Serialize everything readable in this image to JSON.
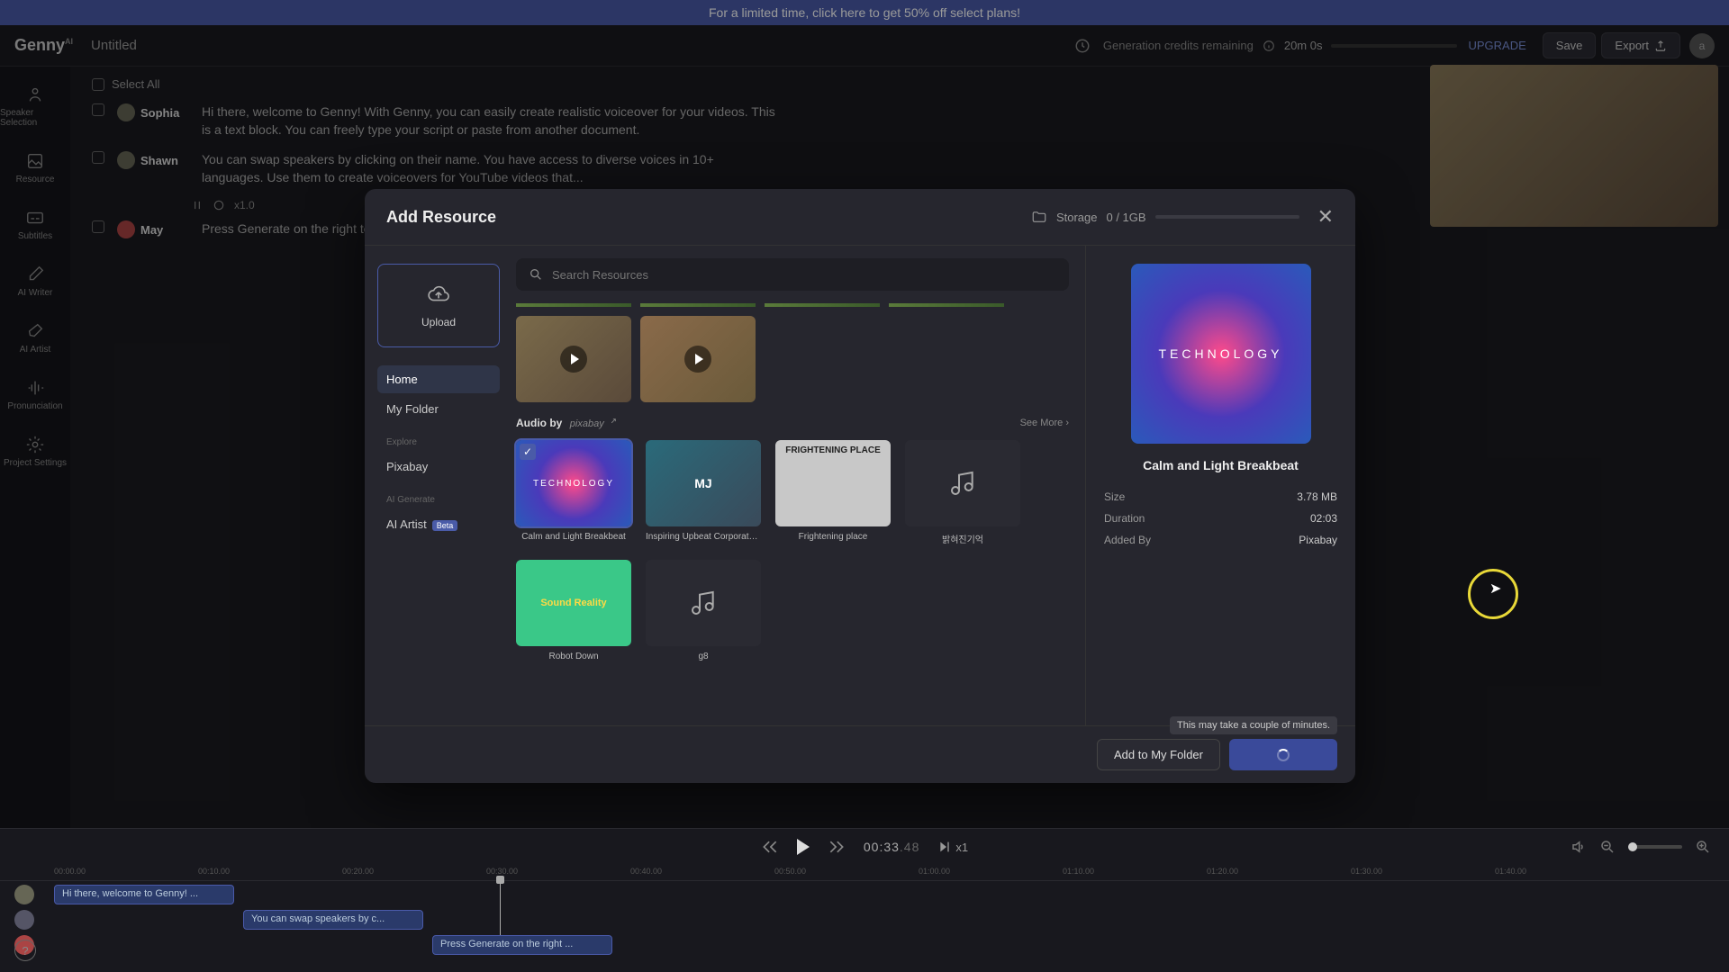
{
  "banner": "For a limited time, click here to get 50% off select plans!",
  "logo": {
    "name": "Genny",
    "sup": "AI"
  },
  "project_title": "Untitled",
  "credits": {
    "label": "Generation credits remaining",
    "time": "20m 0s"
  },
  "upgrade": "UPGRADE",
  "save": "Save",
  "export": "Export",
  "user_initial": "a",
  "sidebar": [
    {
      "label": "Speaker Selection"
    },
    {
      "label": "Resource"
    },
    {
      "label": "Subtitles"
    },
    {
      "label": "AI Writer"
    },
    {
      "label": "AI Artist"
    },
    {
      "label": "Pronunciation"
    },
    {
      "label": "Project Settings"
    }
  ],
  "select_all": "Select All",
  "blocks": [
    {
      "speaker": "Sophia",
      "text": "Hi there, welcome to Genny! With Genny, you can easily create realistic voiceover for your videos. This is a text block. You can freely type your script or paste from another document."
    },
    {
      "speaker": "Shawn",
      "text": "You can swap speakers by clicking on their name. You have access to diverse voices in 10+ languages. Use them to create voiceovers for YouTube videos that..."
    },
    {
      "speaker": "May",
      "text": "Press Generate on the right to see what we sound like. With autogenerate... Happy creating!"
    }
  ],
  "block_speed": "x1.0",
  "modal": {
    "title": "Add Resource",
    "storage": {
      "label": "Storage",
      "value": "0 / 1GB"
    },
    "upload": "Upload",
    "nav": {
      "home": "Home",
      "my_folder": "My Folder",
      "explore_section": "Explore",
      "pixabay": "Pixabay",
      "ai_section": "AI Generate",
      "ai_artist": "AI Artist",
      "beta": "Beta"
    },
    "search_placeholder": "Search Resources",
    "audio_section": {
      "label": "Audio by",
      "brand": "pixabay",
      "see_more": "See More"
    },
    "audio_items": [
      {
        "name": "Calm and Light Breakbeat",
        "thumb_text": "TECHNOLOGY"
      },
      {
        "name": "Inspiring Upbeat Corporate...",
        "thumb_text": "MJ"
      },
      {
        "name": "Frightening place",
        "thumb_text": "FRIGHTENING PLACE"
      },
      {
        "name": "밝혀진기억",
        "thumb_text": ""
      },
      {
        "name": "Robot Down",
        "thumb_text": "Sound Reality"
      },
      {
        "name": "g8",
        "thumb_text": ""
      }
    ],
    "detail": {
      "thumb_text": "TECHNOLOGY",
      "title": "Calm and Light Breakbeat",
      "meta": {
        "size_label": "Size",
        "size": "3.78 MB",
        "duration_label": "Duration",
        "duration": "02:03",
        "added_by_label": "Added By",
        "added_by": "Pixabay"
      }
    },
    "tooltip": "This may take a couple of minutes.",
    "add_folder": "Add to My Folder"
  },
  "playback": {
    "time": "00:33",
    "frac": ".48",
    "speed": "x1"
  },
  "timeline": {
    "ticks": [
      "00:00.00",
      "00:10.00",
      "00:20.00",
      "00:30.00",
      "00:40.00",
      "00:50.00",
      "01:00.00",
      "01:10.00",
      "01:20.00",
      "01:30.00",
      "01:40.00"
    ],
    "clips": [
      {
        "text": "Hi there, welcome to Genny! ..."
      },
      {
        "text": "You can swap speakers by c..."
      },
      {
        "text": "Press Generate on the right ..."
      }
    ]
  },
  "help": "?"
}
